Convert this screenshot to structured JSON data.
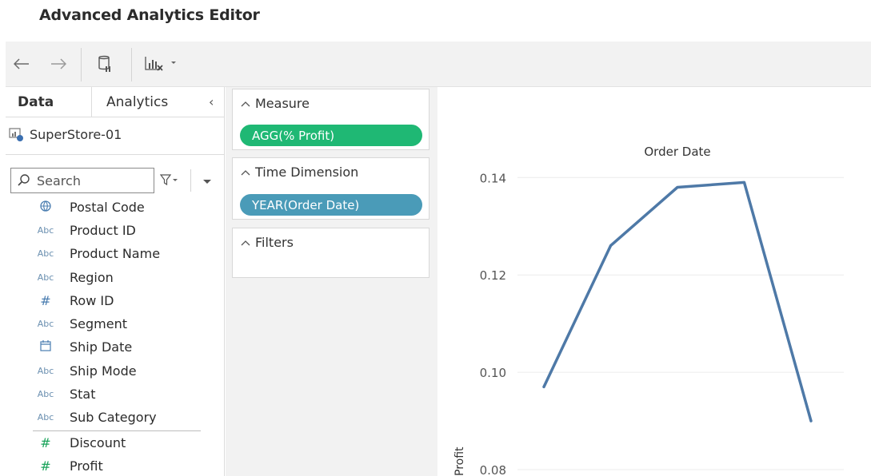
{
  "window": {
    "title": "Advanced Analytics Editor"
  },
  "toolbar": {
    "back_icon": "arrow-left-icon",
    "forward_icon": "arrow-right-icon",
    "datasource_icon": "datasource-pause-icon",
    "chart_icon": "chart-remove-dropdown-icon"
  },
  "left_panel": {
    "tabs": [
      {
        "label": "Data"
      },
      {
        "label": "Analytics"
      }
    ],
    "collapse_glyph": "‹",
    "datasource": {
      "name": "SuperStore-01",
      "icon": "datasource-icon"
    },
    "search": {
      "placeholder": "Search"
    },
    "fields": [
      {
        "type_icon": "globe-icon",
        "type_label": "",
        "label": "Postal Code"
      },
      {
        "type_icon": "text-type-icon",
        "type_label": "Abc",
        "label": "Product ID"
      },
      {
        "type_icon": "text-type-icon",
        "type_label": "Abc",
        "label": "Product Name"
      },
      {
        "type_icon": "text-type-icon",
        "type_label": "Abc",
        "label": "Region"
      },
      {
        "type_icon": "number-type-icon",
        "type_label": "#",
        "label": "Row ID"
      },
      {
        "type_icon": "text-type-icon",
        "type_label": "Abc",
        "label": "Segment"
      },
      {
        "type_icon": "calendar-icon",
        "type_label": "",
        "label": "Ship Date"
      },
      {
        "type_icon": "text-type-icon",
        "type_label": "Abc",
        "label": "Ship Mode"
      },
      {
        "type_icon": "text-type-icon",
        "type_label": "Abc",
        "label": "Stat"
      },
      {
        "type_icon": "text-type-icon",
        "type_label": "Abc",
        "label": "Sub Category"
      },
      {
        "type_icon": "measure-number-icon",
        "type_label": "#",
        "label": "Discount"
      },
      {
        "type_icon": "measure-number-icon",
        "type_label": "#",
        "label": "Profit"
      }
    ]
  },
  "config": {
    "measure": {
      "label": "Measure",
      "pill": "AGG(% Profit)",
      "color": "#1fb874"
    },
    "time_dimension": {
      "label": "Time Dimension",
      "pill": "YEAR(Order Date)",
      "color": "#4a9bb8"
    },
    "filters": {
      "label": "Filters"
    }
  },
  "chart_data": {
    "type": "line",
    "title": "Order Date",
    "ylabel": "Profit",
    "xlabel": "",
    "x": [
      1,
      2,
      3,
      4,
      5
    ],
    "values": [
      0.097,
      0.126,
      0.138,
      0.139,
      0.09
    ],
    "ylim": [
      0.07,
      0.143
    ],
    "yticks": [
      "0.14",
      "0.12",
      "0.10",
      "0.08"
    ],
    "ytick_values": [
      0.14,
      0.12,
      0.1,
      0.08
    ],
    "grid": true,
    "line_color": "#4e79a7"
  }
}
